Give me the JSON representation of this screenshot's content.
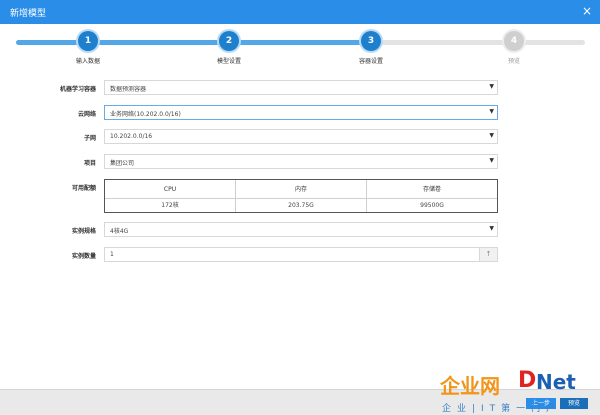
{
  "window": {
    "title": "新增模型",
    "close_symbol": "×"
  },
  "stepper": {
    "steps": [
      {
        "number": "1",
        "label": "输入数据",
        "state": "done"
      },
      {
        "number": "2",
        "label": "模型设置",
        "state": "done"
      },
      {
        "number": "3",
        "label": "容器设置",
        "state": "done"
      },
      {
        "number": "4",
        "label": "预览",
        "state": "todo"
      }
    ]
  },
  "form": {
    "ml_container": {
      "label": "机器学习容器",
      "value": "数据预测容器"
    },
    "cloud_network": {
      "label": "云网络",
      "value": "业务网络(10.202.0.0/16)"
    },
    "subnet": {
      "label": "子网",
      "value": "10.202.0.0/16"
    },
    "project": {
      "label": "项目",
      "value": "集团公司"
    },
    "available_quota": {
      "label": "可用配额",
      "headers": [
        "CPU",
        "内存",
        "存储卷"
      ],
      "values": [
        "172核",
        "203.75G",
        "99500G"
      ]
    },
    "instance_spec": {
      "label": "实例规格",
      "value": "4核4G"
    },
    "instance_count": {
      "label": "实例数量",
      "value": "1"
    }
  },
  "footer": {
    "prev_label": "上一步",
    "preview_label": "预览"
  },
  "watermark": {
    "brand_cn": "企业网",
    "brand_d": "D",
    "brand_net": "Net",
    "subtitle": "企业|IT第一门户"
  },
  "colors": {
    "title_bar": "#2a8ee8",
    "step_done": "#1e7fcd",
    "step_todo": "#cfcfcf",
    "accent_orange": "#f29418",
    "accent_red": "#e02222"
  },
  "icons": {
    "dropdown": "caret-down-icon",
    "close": "close-icon",
    "spin_up": "arrow-up-icon"
  }
}
